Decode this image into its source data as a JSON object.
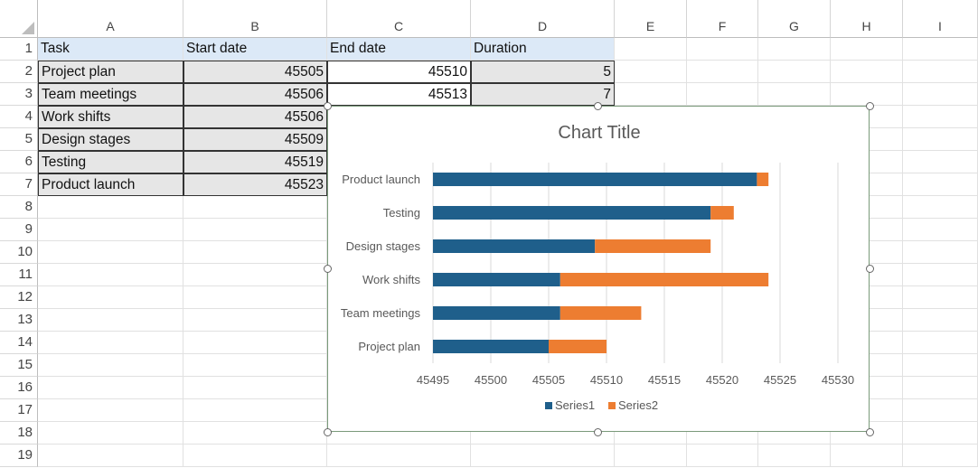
{
  "columns": [
    "A",
    "B",
    "C",
    "D",
    "E",
    "F",
    "G",
    "H",
    "I"
  ],
  "rows": [
    "1",
    "2",
    "3",
    "4",
    "5",
    "6",
    "7",
    "8",
    "9",
    "10",
    "11",
    "12",
    "13",
    "14",
    "15",
    "16",
    "17",
    "18",
    "19"
  ],
  "table": {
    "headers": [
      "Task",
      "Start date",
      "End date",
      "Duration"
    ],
    "rows": [
      {
        "task": "Project plan",
        "start": "45505",
        "end": "45510",
        "duration": "5"
      },
      {
        "task": "Team meetings",
        "start": "45506",
        "end": "45513",
        "duration": "7"
      },
      {
        "task": "Work shifts",
        "start": "45506"
      },
      {
        "task": "Design stages",
        "start": "45509"
      },
      {
        "task": "Testing",
        "start": "45519"
      },
      {
        "task": "Product launch",
        "start": "45523"
      }
    ]
  },
  "chart_data": {
    "type": "bar",
    "orientation": "horizontal",
    "stacked": true,
    "title": "Chart Title",
    "categories": [
      "Project plan",
      "Team meetings",
      "Work shifts",
      "Design stages",
      "Testing",
      "Product launch"
    ],
    "series": [
      {
        "name": "Series1",
        "color": "#1f5f8b",
        "values": [
          45505,
          45506,
          45506,
          45509,
          45519,
          45523
        ]
      },
      {
        "name": "Series2",
        "color": "#ed7d31",
        "values": [
          5,
          7,
          18,
          10,
          2,
          1
        ]
      }
    ],
    "xlim": [
      45495,
      45530
    ],
    "xticks": [
      "45495",
      "45500",
      "45505",
      "45510",
      "45515",
      "45520",
      "45525",
      "45530"
    ],
    "grid": true,
    "legend": "bottom"
  }
}
